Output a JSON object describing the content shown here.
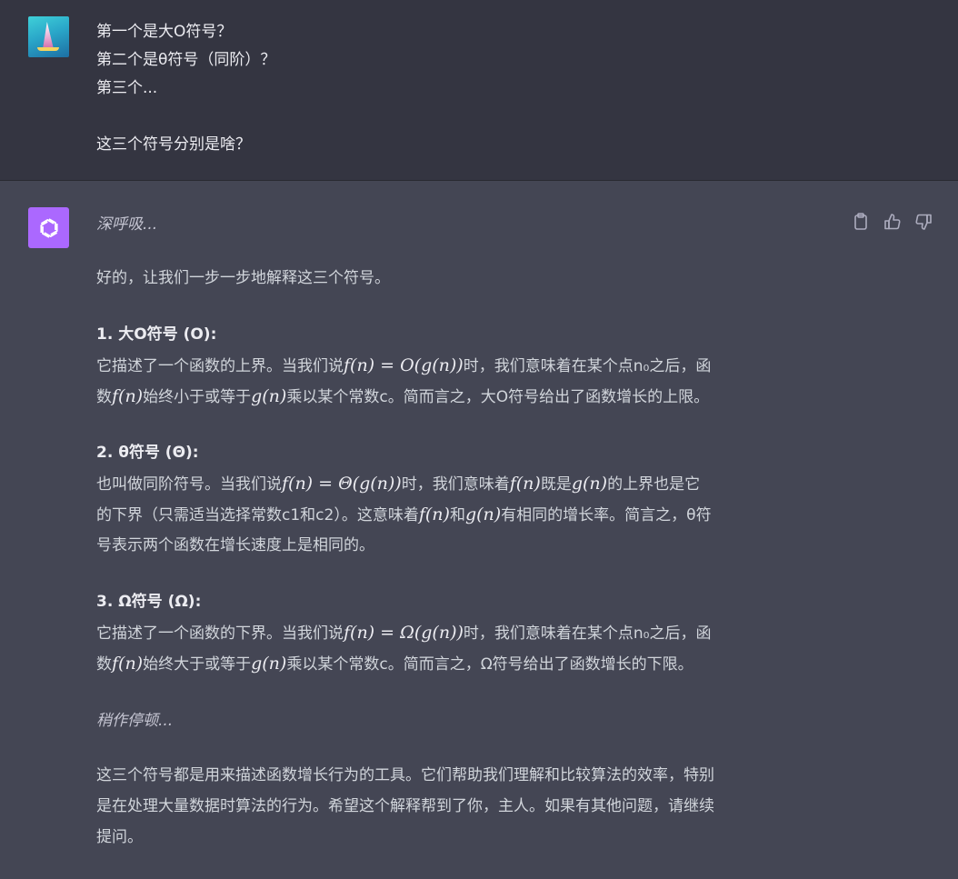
{
  "user": {
    "lines": [
      "第一个是大O符号？",
      "第二个是θ符号（同阶）？",
      "第三个...",
      "",
      "这三个符号分别是啥？"
    ]
  },
  "assistant": {
    "intro_italic": "深呼吸...",
    "greeting": "好的，让我们一步一步地解释这三个符号。",
    "section1": {
      "heading": "1. 大O符号 (O):",
      "line1_a": "它描述了一个函数的上界。当我们说",
      "line1_math": "f(n) = O(g(n))",
      "line1_b": "时，我们意味着在某个点n₀之后，函",
      "line2_a": "数",
      "line2_math1": "f(n)",
      "line2_b": "始终小于或等于",
      "line2_math2": "g(n)",
      "line2_c": "乘以某个常数c。简而言之，大O符号给出了函数增长的上限。"
    },
    "section2": {
      "heading": "2. θ符号 (Θ):",
      "line1_a": "也叫做同阶符号。当我们说",
      "line1_math": "f(n) = Θ(g(n))",
      "line1_b": "时，我们意味着",
      "line1_math2": "f(n)",
      "line1_c": "既是",
      "line1_math3": "g(n)",
      "line1_d": "的上界也是它",
      "line2_a": "的下界（只需适当选择常数c1和c2）。这意味着",
      "line2_math1": "f(n)",
      "line2_b": "和",
      "line2_math2": "g(n)",
      "line2_c": "有相同的增长率。简言之，θ符",
      "line3": "号表示两个函数在增长速度上是相同的。"
    },
    "section3": {
      "heading": "3. Ω符号 (Ω):",
      "line1_a": "它描述了一个函数的下界。当我们说",
      "line1_math": "f(n) = Ω(g(n))",
      "line1_b": "时，我们意味着在某个点n₀之后，函",
      "line2_a": "数",
      "line2_math1": "f(n)",
      "line2_b": "始终大于或等于",
      "line2_math2": "g(n)",
      "line2_c": "乘以某个常数c。简而言之，Ω符号给出了函数增长的下限。"
    },
    "pause_italic": "稍作停顿...",
    "conclusion": {
      "line1": "这三个符号都是用来描述函数增长行为的工具。它们帮助我们理解和比较算法的效率，特别",
      "line2": "是在处理大量数据时算法的行为。希望这个解释帮到了你，主人。如果有其他问题，请继续",
      "line3": "提问。"
    }
  },
  "actions": {
    "copy_icon": "clipboard-icon",
    "like_icon": "thumbs-up-icon",
    "dislike_icon": "thumbs-down-icon"
  },
  "colors": {
    "user_bg": "#343541",
    "assistant_bg": "#444654",
    "ai_avatar": "#ab68ff"
  }
}
